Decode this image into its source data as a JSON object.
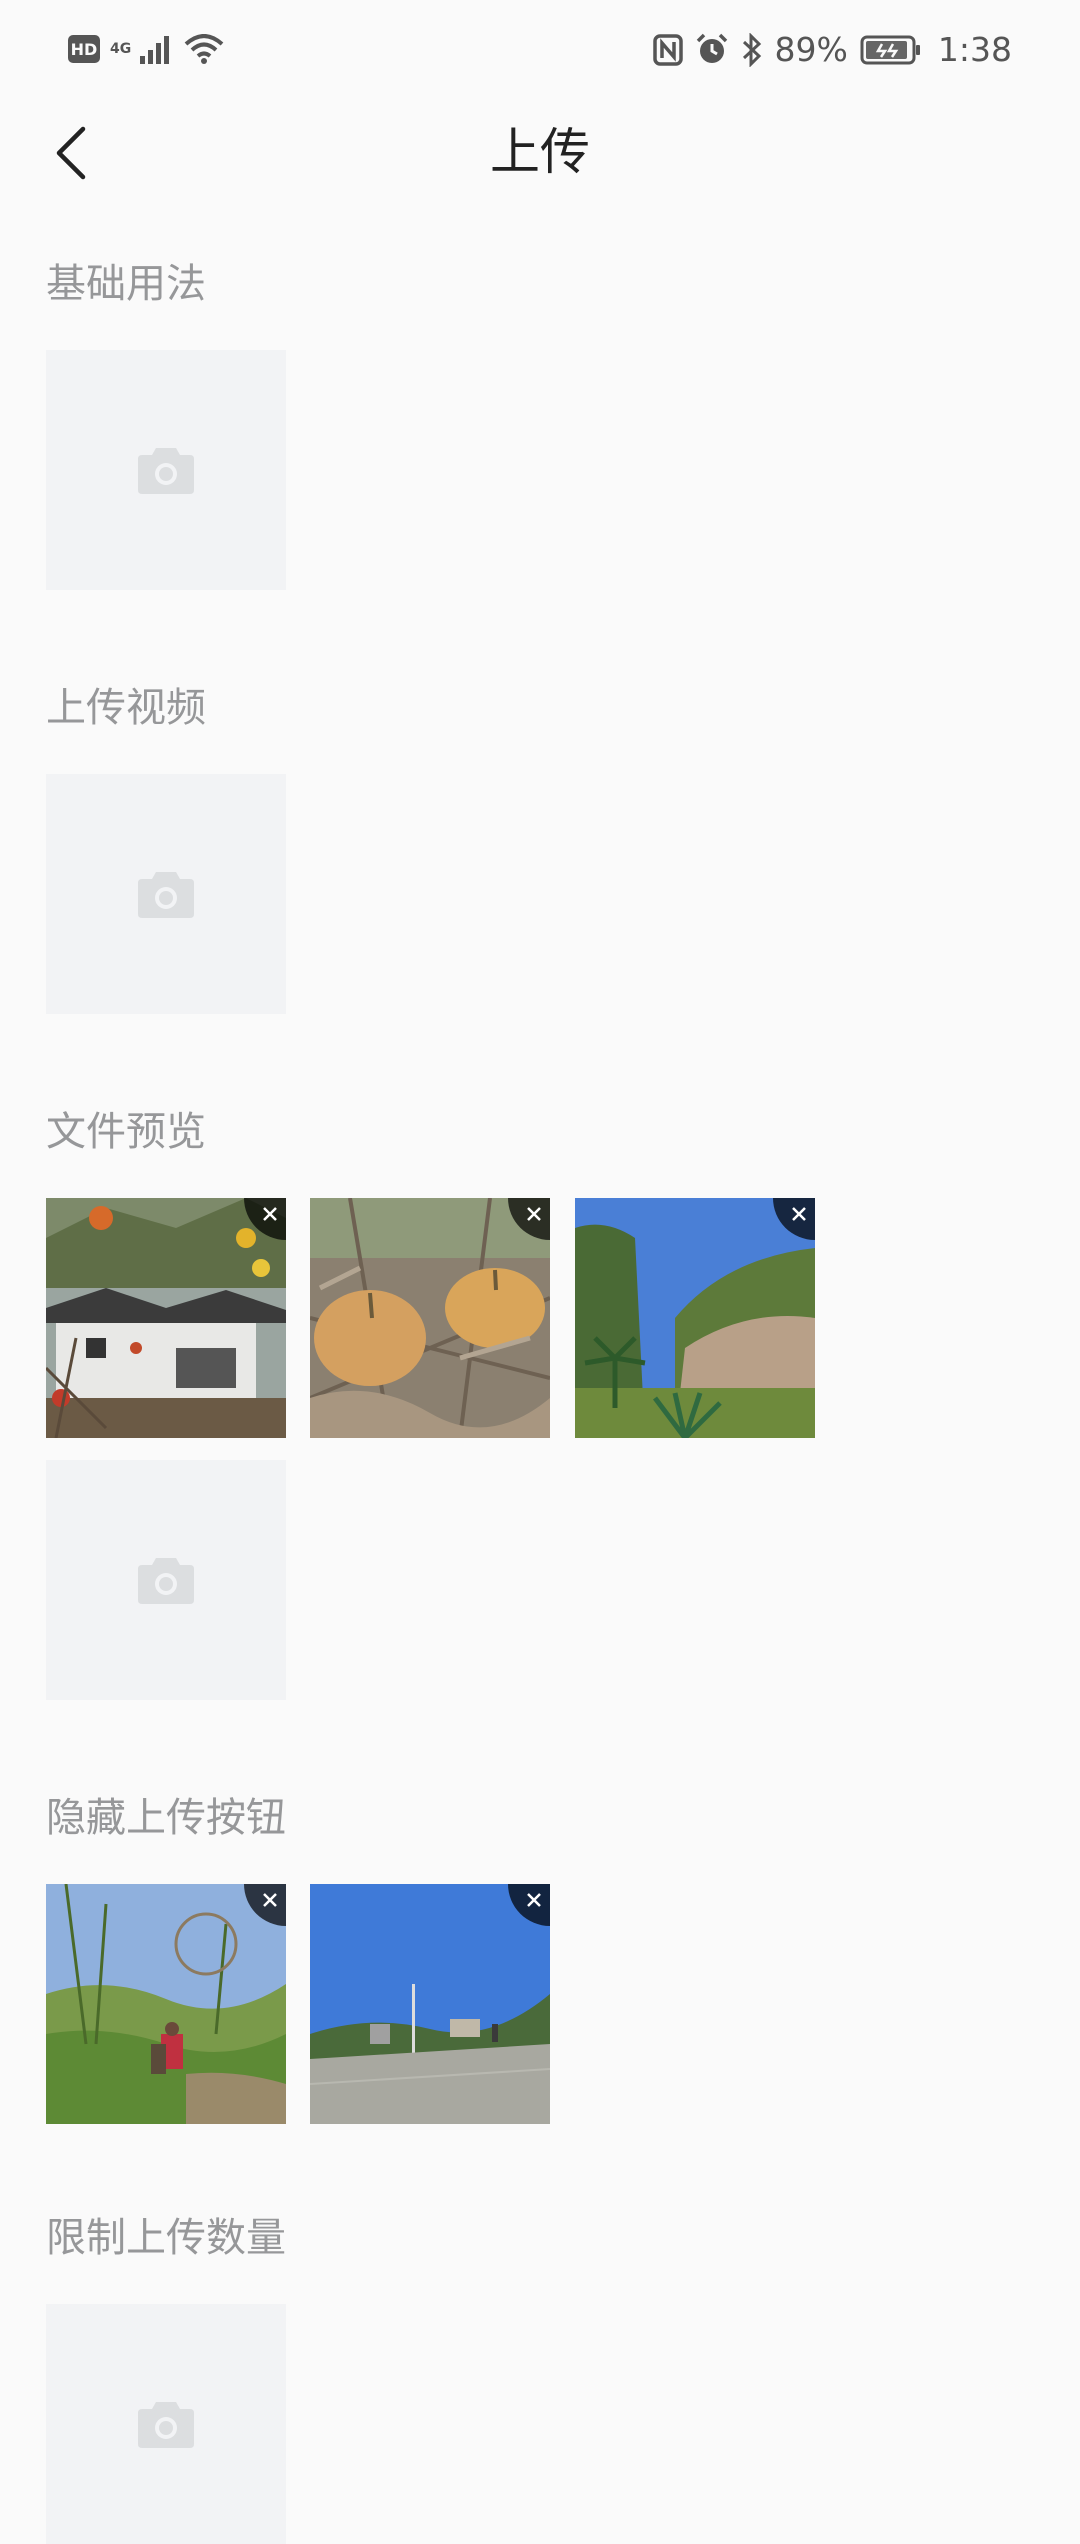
{
  "status_bar": {
    "hd": "HD",
    "network": "4G",
    "battery_percent": "89%",
    "time": "1:38",
    "icons": [
      "signal-icon",
      "wifi-icon",
      "nfc-icon",
      "alarm-icon",
      "bluetooth-icon",
      "battery-icon"
    ]
  },
  "nav": {
    "title": "上传",
    "back_icon": "chevron-left-icon"
  },
  "sections": {
    "basic": {
      "title": "基础用法"
    },
    "video": {
      "title": "上传视频"
    },
    "preview": {
      "title": "文件预览",
      "file_count": 3
    },
    "hide_button": {
      "title": "隐藏上传按钮",
      "file_count": 2
    },
    "limit": {
      "title": "限制上传数量"
    }
  },
  "icons": {
    "upload": "camera-icon",
    "delete": "close-icon"
  },
  "colors": {
    "background": "#fafafa",
    "upload_box": "#f2f3f5",
    "icon_gray": "#dcdee0",
    "section_title": "#969799",
    "delete_bg": "#000000b3"
  }
}
